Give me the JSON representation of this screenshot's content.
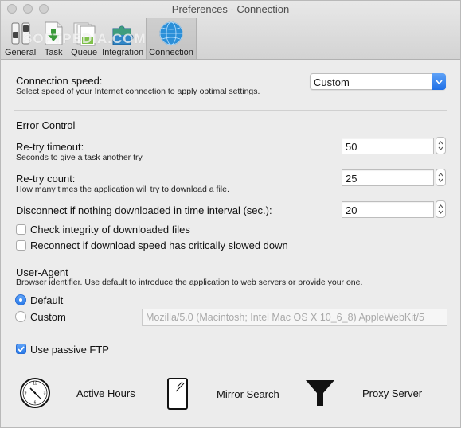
{
  "window": {
    "title": "Preferences - Connection",
    "watermark": "SOFTPEDIA.COM"
  },
  "toolbar": {
    "items": [
      {
        "label": "General",
        "icon": "switches-icon",
        "active": false
      },
      {
        "label": "Task",
        "icon": "download-document-icon",
        "active": false
      },
      {
        "label": "Queue",
        "icon": "stacked-documents-icon",
        "active": false
      },
      {
        "label": "Integration",
        "icon": "puzzle-icon",
        "active": false
      },
      {
        "label": "Connection",
        "icon": "globe-icon",
        "active": true
      }
    ]
  },
  "connection_speed": {
    "label": "Connection speed:",
    "description": "Select speed of your Internet connection to apply optimal settings.",
    "selected": "Custom"
  },
  "error_control": {
    "heading": "Error Control",
    "retry_timeout": {
      "label": "Re-try timeout:",
      "description": "Seconds to give a task another try.",
      "value": "50"
    },
    "retry_count": {
      "label": "Re-try count:",
      "description": "How many times the application will try to download a file.",
      "value": "25"
    },
    "disconnect": {
      "label": "Disconnect if nothing downloaded in time interval (sec.):",
      "value": "20"
    },
    "check_integrity": {
      "label": "Check integrity of downloaded files",
      "checked": false
    },
    "reconnect": {
      "label": "Reconnect if download speed has critically slowed down",
      "checked": false
    }
  },
  "user_agent": {
    "heading": "User-Agent",
    "description": "Browser identifier. Use default to introduce the application to web servers or provide your one.",
    "default_label": "Default",
    "custom_label": "Custom",
    "selected": "Default",
    "custom_value": "Mozilla/5.0 (Macintosh; Intel Mac OS X 10_6_8) AppleWebKit/5"
  },
  "passive_ftp": {
    "label": "Use passive FTP",
    "checked": true
  },
  "bottom_buttons": [
    {
      "label": "Active Hours",
      "icon": "clock-icon"
    },
    {
      "label": "Mirror Search",
      "icon": "mirror-icon"
    },
    {
      "label": "Proxy Server",
      "icon": "funnel-icon"
    }
  ],
  "colors": {
    "accent": "#2a7be9",
    "window_bg": "#ececec",
    "separator": "#d0d0d0"
  }
}
